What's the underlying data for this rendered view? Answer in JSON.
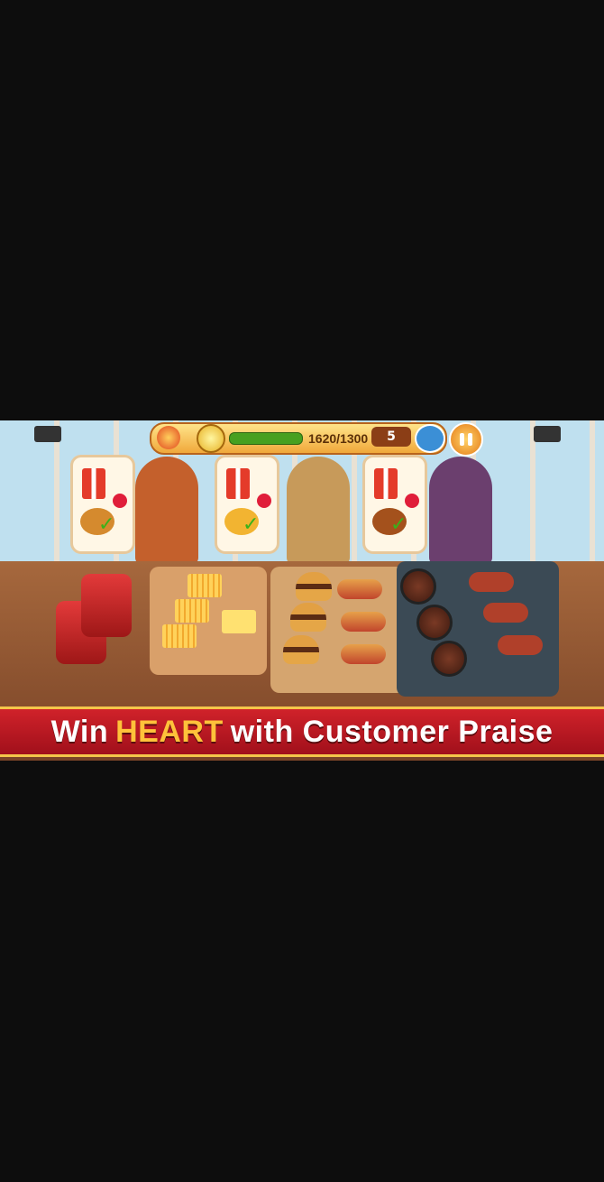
{
  "hud": {
    "score": "1620/1300",
    "score_fraction": 1.0,
    "level": "5",
    "icons": [
      "flame-icon",
      "coin-icon",
      "people-icon",
      "pause-icon"
    ]
  },
  "orders": [
    {
      "drink": "cola",
      "food": "hotdog",
      "served": true
    },
    {
      "drink": "cola",
      "food": "fries",
      "served": true
    },
    {
      "drink": "cola",
      "food": "burger",
      "served": true
    }
  ],
  "banner": {
    "prefix": "Win",
    "highlight": "HEART",
    "suffix": "with Customer Praise"
  },
  "colors": {
    "banner_red": "#c91a24",
    "highlight": "#ffc23a",
    "progress_green": "#46a020"
  }
}
